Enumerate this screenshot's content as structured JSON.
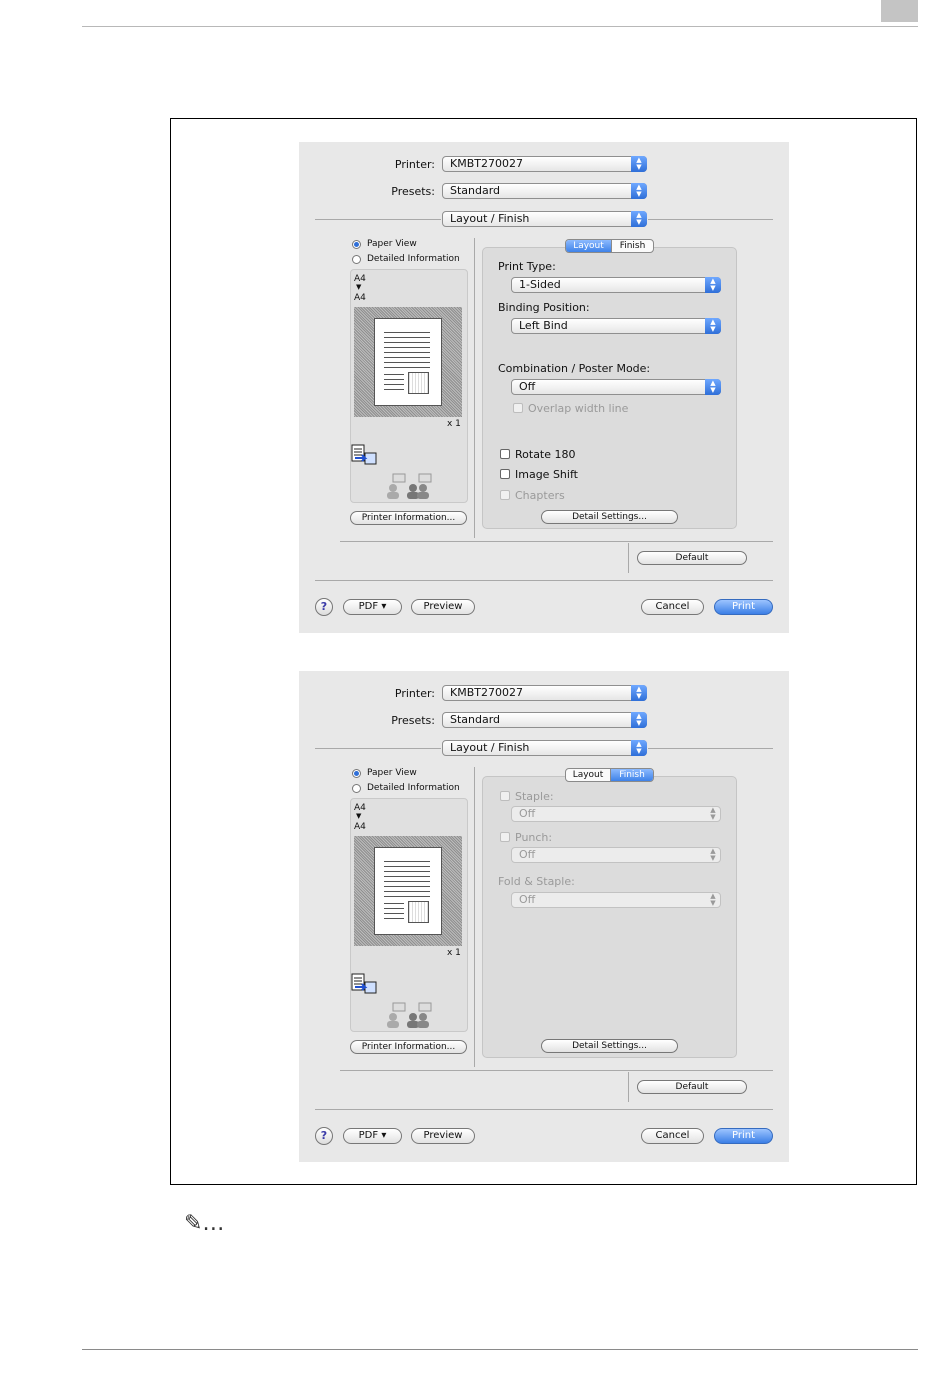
{
  "page": {
    "note_glyph": "✎…"
  },
  "dialogs": [
    {
      "printer_label": "Printer:",
      "printer_value": "KMBT270027",
      "presets_label": "Presets:",
      "presets_value": "Standard",
      "pane_value": "Layout / Finish",
      "view_paper": "Paper View",
      "view_detail": "Detailed Information",
      "paper_from": "A4",
      "paper_arrow": "▼",
      "paper_to": "A4",
      "copies": "x 1",
      "printer_info_button": "Printer Information...",
      "tab_layout": "Layout",
      "tab_finish": "Finish",
      "selected_tab": "layout",
      "detail_settings_button": "Detail Settings...",
      "default_button": "Default",
      "pdf_button": "PDF ▾",
      "preview_button": "Preview",
      "cancel_button": "Cancel",
      "print_button": "Print",
      "help_glyph": "?",
      "layout": {
        "print_type_label": "Print Type:",
        "print_type_value": "1-Sided",
        "binding_label": "Binding Position:",
        "binding_value": "Left Bind",
        "combination_label": "Combination / Poster Mode:",
        "combination_value": "Off",
        "overlap_label": "Overlap width line",
        "rotate_label": "Rotate 180",
        "image_shift_label": "Image Shift",
        "chapters_label": "Chapters"
      }
    },
    {
      "printer_label": "Printer:",
      "printer_value": "KMBT270027",
      "presets_label": "Presets:",
      "presets_value": "Standard",
      "pane_value": "Layout / Finish",
      "view_paper": "Paper View",
      "view_detail": "Detailed Information",
      "paper_from": "A4",
      "paper_arrow": "▼",
      "paper_to": "A4",
      "copies": "x 1",
      "printer_info_button": "Printer Information...",
      "tab_layout": "Layout",
      "tab_finish": "Finish",
      "selected_tab": "finish",
      "detail_settings_button": "Detail Settings...",
      "default_button": "Default",
      "pdf_button": "PDF ▾",
      "preview_button": "Preview",
      "cancel_button": "Cancel",
      "print_button": "Print",
      "help_glyph": "?",
      "finish": {
        "staple_label": "Staple:",
        "staple_value": "Off",
        "punch_label": "Punch:",
        "punch_value": "Off",
        "fold_label": "Fold & Staple:",
        "fold_value": "Off"
      }
    }
  ]
}
